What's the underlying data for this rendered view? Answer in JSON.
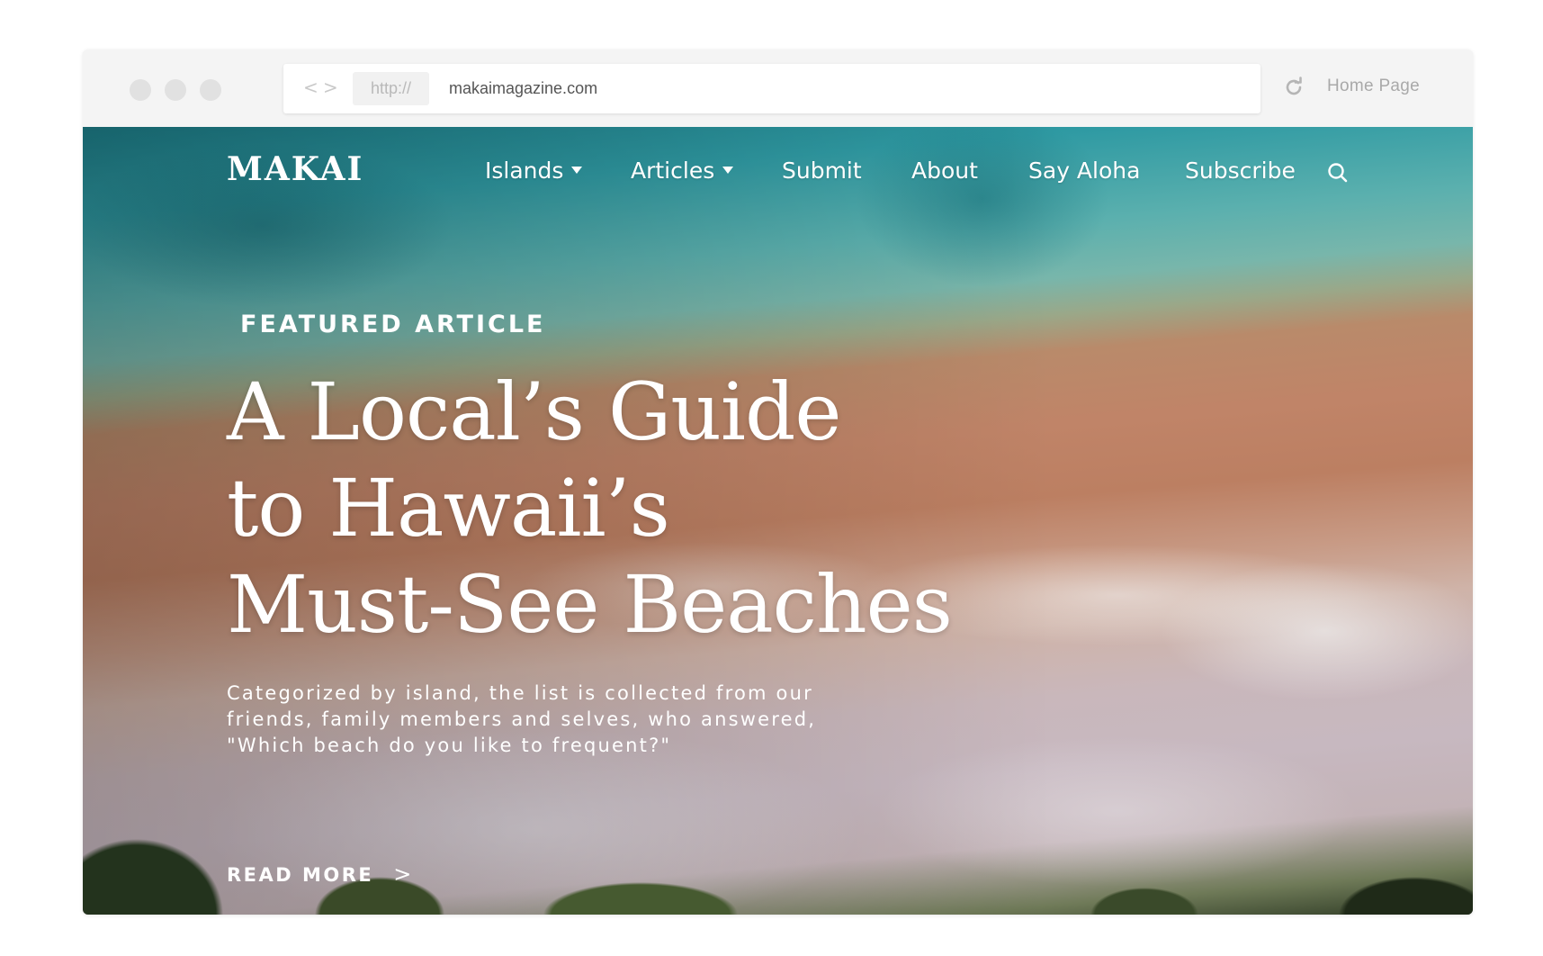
{
  "browser": {
    "back_arrow": "<",
    "forward_arrow": ">",
    "protocol": "http://",
    "url": "makaimagazine.com",
    "home_link": "Home Page"
  },
  "site": {
    "logo": "MAKAI",
    "nav": [
      {
        "label": "Islands",
        "has_dropdown": true
      },
      {
        "label": "Articles",
        "has_dropdown": true
      },
      {
        "label": "Submit",
        "has_dropdown": false
      },
      {
        "label": "About",
        "has_dropdown": false
      },
      {
        "label": "Say Aloha",
        "has_dropdown": false
      },
      {
        "label": "Subscribe",
        "has_dropdown": false
      }
    ],
    "search_icon": "search-icon"
  },
  "hero": {
    "eyebrow": "FEATURED ARTICLE",
    "headline_lines": [
      "A Local’s Guide",
      "to Hawaii’s",
      "Must-See Beaches"
    ],
    "deck_lines": [
      "Categorized by island, the list is collected from our",
      "friends, family members and selves, who answered,",
      "\"Which beach do you like to frequent?\""
    ],
    "cta": "READ MORE",
    "cta_icon": "chevron-right-icon"
  },
  "colors": {
    "browser_chrome": "#f4f4f4",
    "window_dot": "#e1e1e1",
    "hero_text": "#ffffff",
    "ocean": "#2f9aa3",
    "sand": "#c08468"
  }
}
